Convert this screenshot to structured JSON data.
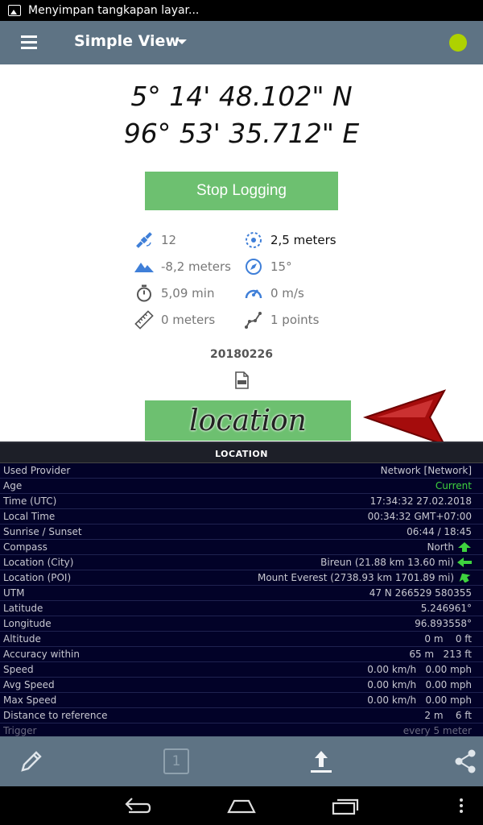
{
  "status_bar": {
    "notification": "Menyimpan tangkapan layar..."
  },
  "app_bar": {
    "title": "Simple View",
    "status_color": "#aed100"
  },
  "coordinates": {
    "latitude": "5° 14' 48.102\" N",
    "longitude": "96° 53' 35.712\" E"
  },
  "logging_button": {
    "label": "Stop Logging",
    "color": "#6dc070"
  },
  "stats": {
    "satellites": "12",
    "accuracy": "2,5 meters",
    "altitude": "-8,2 meters",
    "bearing": "15°",
    "duration": "5,09 min",
    "speed": "0 m/s",
    "distance": "0 meters",
    "points": "1 points"
  },
  "file_name": "20180226",
  "overlay_label": "location",
  "location_panel": {
    "header": "LOCATION",
    "rows": [
      {
        "label": "Used Provider",
        "value": "Network [Network]"
      },
      {
        "label": "Age",
        "value": "Current"
      },
      {
        "label": "Time (UTC)",
        "value": "17:34:32 27.02.2018"
      },
      {
        "label": "Local Time",
        "value": "00:34:32 GMT+07:00"
      },
      {
        "label": "Sunrise / Sunset",
        "value": "06:44 / 18:45"
      },
      {
        "label": "Compass",
        "value": "North"
      },
      {
        "label": "Location (City)",
        "value": "Bireun (21.88 km 13.60 mi)"
      },
      {
        "label": "Location (POI)",
        "value": "Mount Everest (2738.93 km 1701.89 mi)"
      },
      {
        "label": "UTM",
        "value": "47 N 266529 580355"
      },
      {
        "label": "Latitude",
        "value": "5.246961°"
      },
      {
        "label": "Longitude",
        "value": "96.893558°"
      },
      {
        "label": "Altitude",
        "value": "0 m    0 ft"
      },
      {
        "label": "Accuracy within",
        "value": "65 m   213 ft"
      },
      {
        "label": "Speed",
        "value": "0.00 km/h   0.00 mph"
      },
      {
        "label": "Avg Speed",
        "value": "0.00 km/h   0.00 mph"
      },
      {
        "label": "Max Speed",
        "value": "0.00 km/h   0.00 mph"
      },
      {
        "label": "Distance to reference",
        "value": "2 m    6 ft"
      },
      {
        "label": "Trigger",
        "value": "every 5 meter"
      }
    ]
  },
  "toolbar": {
    "page_number": "1"
  }
}
